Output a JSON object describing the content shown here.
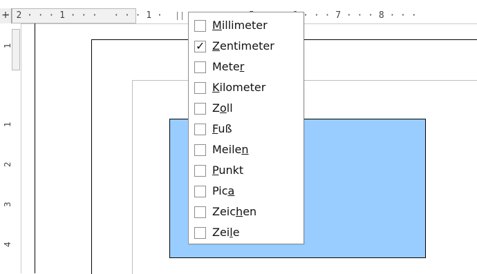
{
  "ruler": {
    "corner_icon": "+",
    "horizontal_text": " · 2 · · · 1 · · ·   · · · 1 ·              · 5 · · · 6 · · · 7 · · · 8 · · ·",
    "vertical_labels": [
      "1",
      "1",
      "2",
      "3",
      "4"
    ]
  },
  "menu": {
    "items": [
      {
        "pre": "",
        "mn": "M",
        "post": "illimeter",
        "checked": false
      },
      {
        "pre": "",
        "mn": "Z",
        "post": "entimeter",
        "checked": true
      },
      {
        "pre": "Mete",
        "mn": "r",
        "post": "",
        "checked": false
      },
      {
        "pre": "",
        "mn": "K",
        "post": "ilometer",
        "checked": false
      },
      {
        "pre": "Z",
        "mn": "o",
        "post": "ll",
        "checked": false
      },
      {
        "pre": "",
        "mn": "F",
        "post": "uß",
        "checked": false
      },
      {
        "pre": "Meile",
        "mn": "n",
        "post": "",
        "checked": false
      },
      {
        "pre": "",
        "mn": "P",
        "post": "unkt",
        "checked": false
      },
      {
        "pre": "Pic",
        "mn": "a",
        "post": "",
        "checked": false
      },
      {
        "pre": "Zeic",
        "mn": "h",
        "post": "en",
        "checked": false
      },
      {
        "pre": "Zei",
        "mn": "l",
        "post": "e",
        "checked": false
      }
    ]
  },
  "colors": {
    "shape_fill": "#99ccff"
  }
}
